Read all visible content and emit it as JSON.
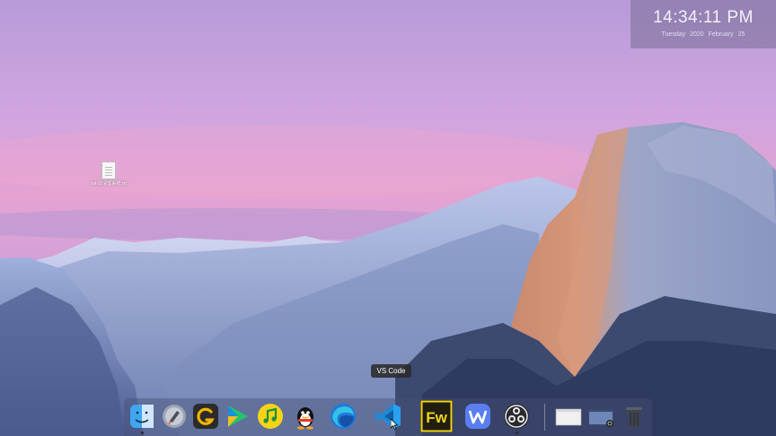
{
  "clock": {
    "time": "14:34:11 PM",
    "date": "Tuesday  2020  February  25"
  },
  "desktop": {
    "file_name": "win10清理系统.txt"
  },
  "dock": {
    "tooltip": "VS Code",
    "items": [
      {
        "name": "Finder",
        "icon": "finder-icon",
        "running": true
      },
      {
        "name": "Launchpad",
        "icon": "launchpad-icon",
        "running": false
      },
      {
        "name": "Grammarly",
        "icon": "g-app-icon",
        "running": false
      },
      {
        "name": "Media Player",
        "icon": "play-icon",
        "running": false
      },
      {
        "name": "Music",
        "icon": "music-icon",
        "running": false
      },
      {
        "name": "QQ",
        "icon": "qq-penguin-icon",
        "running": false
      },
      {
        "name": "Edge",
        "icon": "edge-icon",
        "running": false
      },
      {
        "name": "VS Code",
        "icon": "vscode-icon",
        "running": false
      },
      {
        "name": "Fireworks",
        "icon": "fw-icon",
        "running": false,
        "label": "Fw"
      },
      {
        "name": "WPS Office",
        "icon": "wps-icon",
        "running": false
      },
      {
        "name": "OBS",
        "icon": "obs-icon",
        "running": true
      },
      {
        "name": "Window 1",
        "icon": "window-thumbnail-icon",
        "running": false
      },
      {
        "name": "Window 2",
        "icon": "window-thumbnail-icon",
        "running": false
      },
      {
        "name": "Trash",
        "icon": "trash-icon",
        "running": false
      }
    ]
  },
  "colors": {
    "sky_top": "#c9a6e3",
    "sky_pink": "#e0a2d0",
    "mountain": "#8e9fc8",
    "dock_bg": "#465078"
  }
}
